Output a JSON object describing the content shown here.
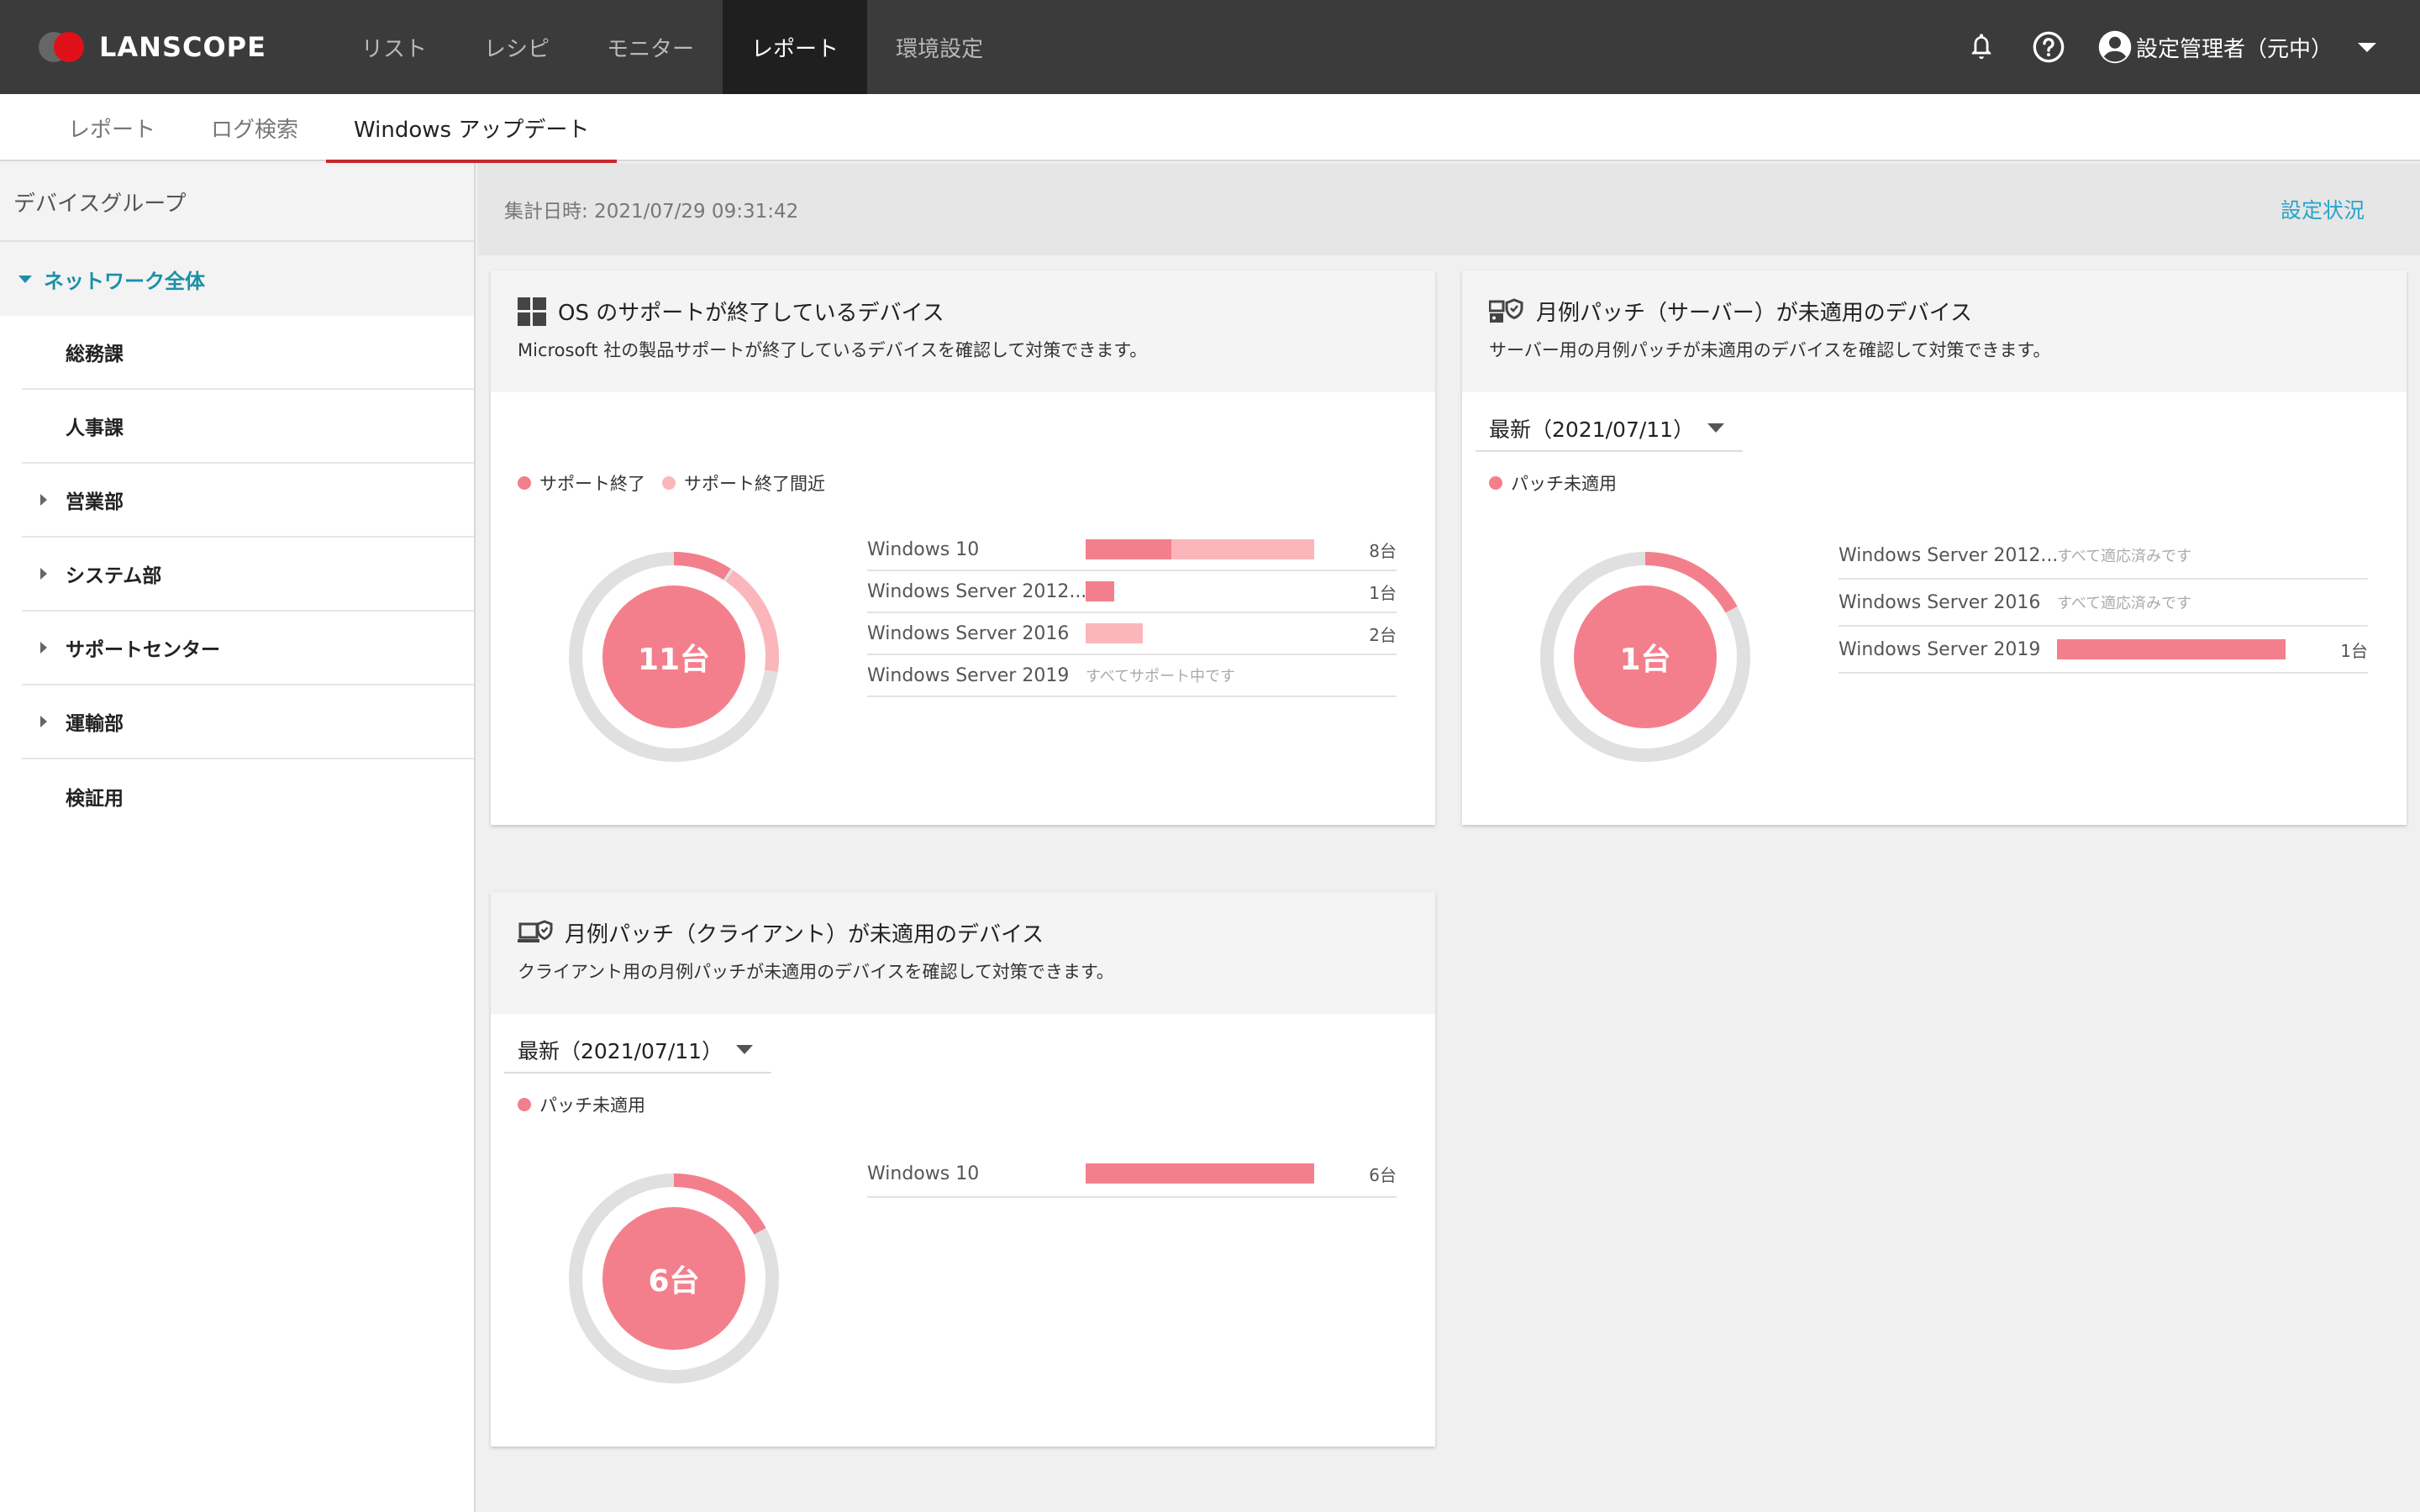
{
  "app": {
    "logo_text": "LANSCOPE",
    "colors": {
      "topbar": "#3b3b3b",
      "accent_red": "#c8262e",
      "link": "#2aa4c8",
      "support_end": "#f47f8c",
      "support_near": "#fbb6bc",
      "track": "#e0e0e0"
    }
  },
  "nav": {
    "items": [
      "リスト",
      "レシピ",
      "モニター",
      "レポート",
      "環境設定"
    ],
    "active": "レポート",
    "icons": [
      "bell-icon",
      "help-icon",
      "account-icon"
    ],
    "user_name": "設定管理者（元中）"
  },
  "subtabs": {
    "items": [
      "レポート",
      "ログ検索",
      "Windows アップデート"
    ],
    "active": "Windows アップデート"
  },
  "sidebar": {
    "title": "デバイスグループ",
    "root": "ネットワーク全体",
    "items": [
      {
        "label": "総務課",
        "expandable": false
      },
      {
        "label": "人事課",
        "expandable": false
      },
      {
        "label": "営業部",
        "expandable": true
      },
      {
        "label": "システム部",
        "expandable": true
      },
      {
        "label": "サポートセンター",
        "expandable": true
      },
      {
        "label": "運輸部",
        "expandable": true
      },
      {
        "label": "検証用",
        "expandable": false
      }
    ]
  },
  "main": {
    "stamp": "集計日時: 2021/07/29 09:31:42",
    "settings_link": "設定状況"
  },
  "cards": {
    "os": {
      "title": "OS のサポートが終了しているデバイス",
      "desc": "Microsoft 社の製品サポートが終了しているデバイスを確認して対策できます。",
      "legend": [
        "サポート終了",
        "サポート終了間近"
      ],
      "total": "11台",
      "total_value": 11,
      "donut": {
        "end": 1,
        "near": 2
      },
      "rows": [
        {
          "name": "Windows 10",
          "end": 3,
          "near": 5,
          "count": "8台",
          "note": ""
        },
        {
          "name": "Windows Server 2012...",
          "end": 1,
          "near": 0,
          "count": "1台",
          "note": ""
        },
        {
          "name": "Windows Server 2016",
          "end": 0,
          "near": 2,
          "count": "2台",
          "note": ""
        },
        {
          "name": "Windows Server 2019",
          "end": 0,
          "near": 0,
          "count": "",
          "note": "すべてサポート中です"
        }
      ]
    },
    "server": {
      "title": "月例パッチ（サーバー）が未適用のデバイス",
      "desc": "サーバー用の月例パッチが未適用のデバイスを確認して対策できます。",
      "select": "最新（2021/07/11）",
      "legend": [
        "パッチ未適用"
      ],
      "total": "1台",
      "total_value": 1,
      "donut_fraction": 0.17,
      "rows": [
        {
          "name": "Windows Server 2012...",
          "value": 0,
          "count": "",
          "note": "すべて適応済みです"
        },
        {
          "name": "Windows Server 2016",
          "value": 0,
          "count": "",
          "note": "すべて適応済みです"
        },
        {
          "name": "Windows Server 2019",
          "value": 1,
          "count": "1台",
          "note": ""
        }
      ]
    },
    "client": {
      "title": "月例パッチ（クライアント）が未適用のデバイス",
      "desc": "クライアント用の月例パッチが未適用のデバイスを確認して対策できます。",
      "select": "最新（2021/07/11）",
      "legend": [
        "パッチ未適用"
      ],
      "total": "6台",
      "total_value": 6,
      "donut_fraction": 0.17,
      "rows": [
        {
          "name": "Windows 10",
          "value": 6,
          "count": "6台",
          "note": ""
        }
      ]
    }
  }
}
